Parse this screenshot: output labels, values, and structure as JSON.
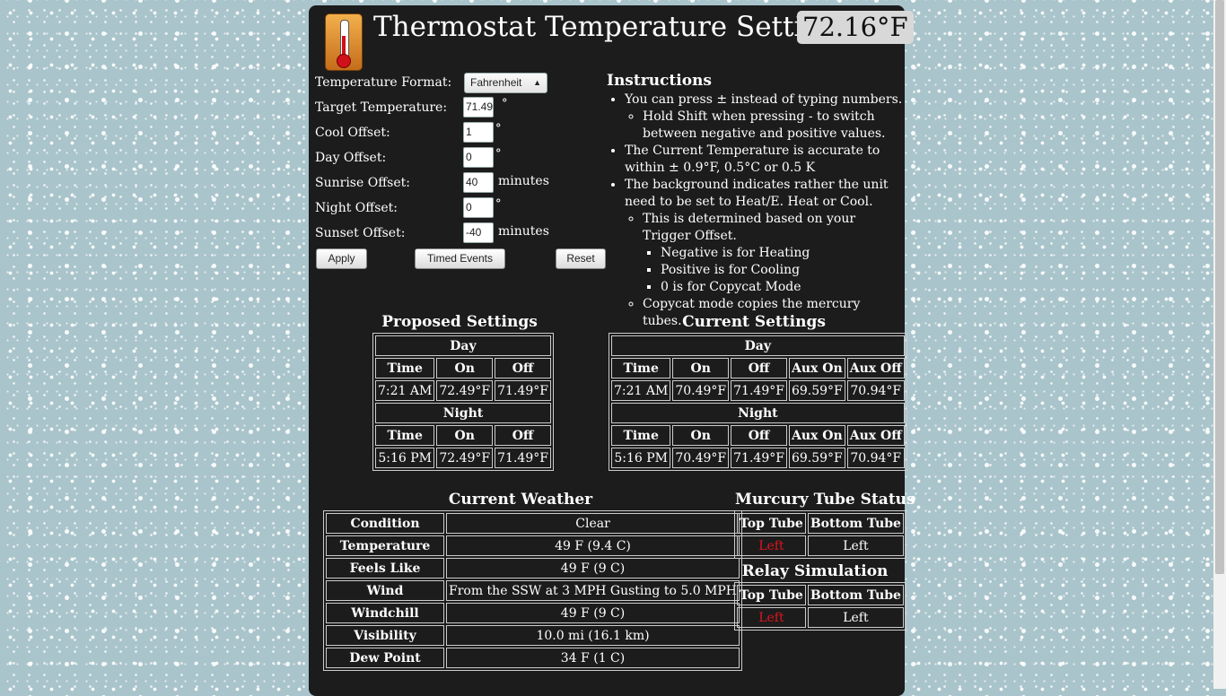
{
  "header": {
    "title": "Thermostat Temperature Settings",
    "current_temp": "72.16°F"
  },
  "form": {
    "format_label": "Temperature Format:",
    "format_value": "Fahrenheit",
    "fields": [
      {
        "label": "Target Temperature:",
        "value": "71.49",
        "unit": "°"
      },
      {
        "label": "Cool Offset:",
        "value": "1",
        "unit": "°"
      },
      {
        "label": "Day Offset:",
        "value": "0",
        "unit": "°"
      },
      {
        "label": "Sunrise Offset:",
        "value": "40",
        "unit": "minutes"
      },
      {
        "label": "Night Offset:",
        "value": "0",
        "unit": "°"
      },
      {
        "label": "Sunset Offset:",
        "value": "-40",
        "unit": "minutes"
      }
    ],
    "buttons": {
      "apply": "Apply",
      "timed_events": "Timed Events",
      "reset": "Reset"
    }
  },
  "instructions": {
    "title": "Instructions",
    "item1": "You can press ± instead of typing numbers.",
    "item1_sub1": "Hold Shift when pressing - to switch between negative and positive values.",
    "item2": "The Current Temperature is accurate to within ± 0.9°F, 0.5°C or 0.5 K",
    "item3": "The background indicates rather the unit need to be set to Heat/E. Heat or Cool.",
    "item3_sub1": "This is determined based on your Trigger Offset.",
    "item3_sub1_a": "Negative is for Heating",
    "item3_sub1_b": "Positive is for Cooling",
    "item3_sub1_c": "0 is for Copycat Mode",
    "item3_sub2": "Copycat mode copies the mercury tubes."
  },
  "proposed": {
    "title": "Proposed Settings",
    "day_label": "Day",
    "night_label": "Night",
    "headers": [
      "Time",
      "On",
      "Off"
    ],
    "day": [
      "7:21 AM",
      "72.49°F",
      "71.49°F"
    ],
    "night": [
      "5:16 PM",
      "72.49°F",
      "71.49°F"
    ]
  },
  "current": {
    "title": "Current Settings",
    "day_label": "Day",
    "night_label": "Night",
    "headers": [
      "Time",
      "On",
      "Off",
      "Aux On",
      "Aux Off"
    ],
    "day": [
      "7:21 AM",
      "70.49°F",
      "71.49°F",
      "69.59°F",
      "70.94°F"
    ],
    "night": [
      "5:16 PM",
      "70.49°F",
      "71.49°F",
      "69.59°F",
      "70.94°F"
    ]
  },
  "weather": {
    "title": "Current Weather",
    "rows": [
      {
        "label": "Condition",
        "value": "Clear"
      },
      {
        "label": "Temperature",
        "value": "49 F (9.4 C)"
      },
      {
        "label": "Feels Like",
        "value": "49 F (9 C)"
      },
      {
        "label": "Wind",
        "value": "From the SSW at 3 MPH Gusting to 5.0 MPH"
      },
      {
        "label": "Windchill",
        "value": "49 F (9 C)"
      },
      {
        "label": "Visibility",
        "value": "10.0 mi (16.1 km)"
      },
      {
        "label": "Dew Point",
        "value": "34 F (1 C)"
      }
    ]
  },
  "tubes": {
    "title": "Murcury Tube Status",
    "headers": [
      "Top Tube",
      "Bottom Tube"
    ],
    "values": [
      "Left",
      "Left"
    ],
    "status_color": "#e0141e"
  },
  "relay": {
    "title": "Relay Simulation",
    "headers": [
      "Top Tube",
      "Bottom Tube"
    ],
    "values": [
      "Left",
      "Left"
    ]
  }
}
